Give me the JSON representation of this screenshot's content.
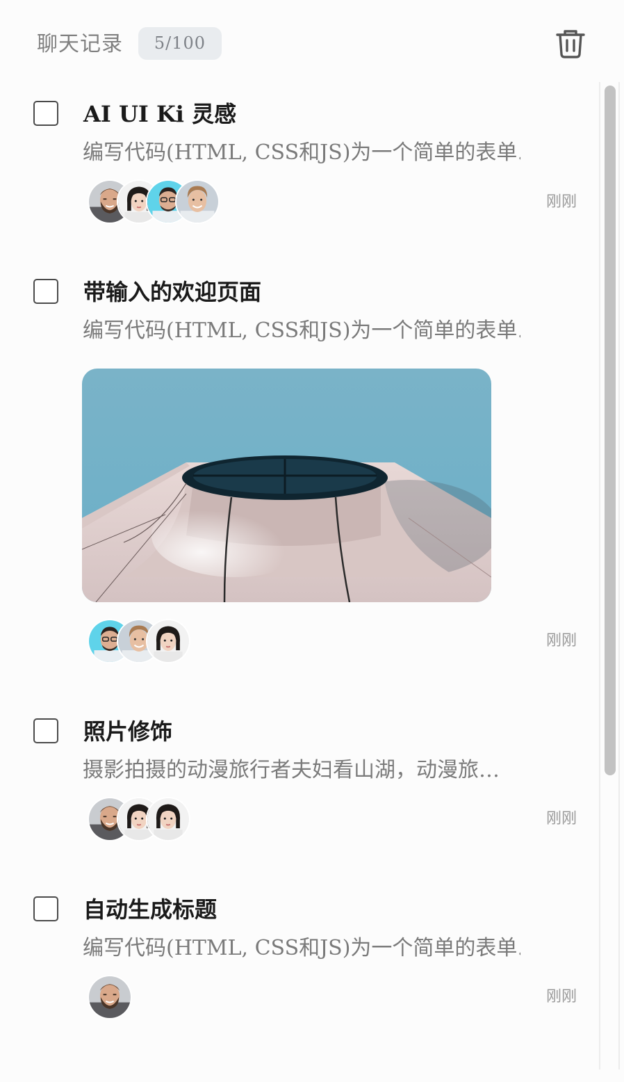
{
  "header": {
    "title": "聊天记录",
    "count": "5/100",
    "delete_icon": "trash-icon"
  },
  "items": [
    {
      "title": "AI UI Ki 灵感",
      "desc": "编写代码(HTML, CSS和JS)为一个简单的表单…",
      "avatars": [
        "bearded-man",
        "woman-bob",
        "man-glasses",
        "blond-man"
      ],
      "time": "刚刚",
      "checked": false
    },
    {
      "title": "带输入的欢迎页面",
      "desc": "编写代码(HTML, CSS和JS)为一个简单的表单…",
      "image": "3d-render-round-structure",
      "avatars": [
        "man-glasses",
        "blond-man",
        "woman-bob"
      ],
      "time": "刚刚",
      "checked": false
    },
    {
      "title": "照片修饰",
      "desc": "摄影拍摄的动漫旅行者夫妇看山湖，动漫旅…",
      "avatars": [
        "bearded-man",
        "woman-bob",
        "woman-bob"
      ],
      "time": "刚刚",
      "checked": false
    },
    {
      "title": "自动生成标题",
      "desc": "编写代码(HTML, CSS和JS)为一个简单的表单…",
      "avatars": [
        "bearded-man"
      ],
      "time": "刚刚",
      "checked": false
    }
  ],
  "colors": {
    "background": "#fcfcfc",
    "badge_bg": "#e9ecef",
    "scrollbar": "#c2c2c2",
    "title_text": "#1a1a1a",
    "muted_text": "#7a7a7a"
  }
}
